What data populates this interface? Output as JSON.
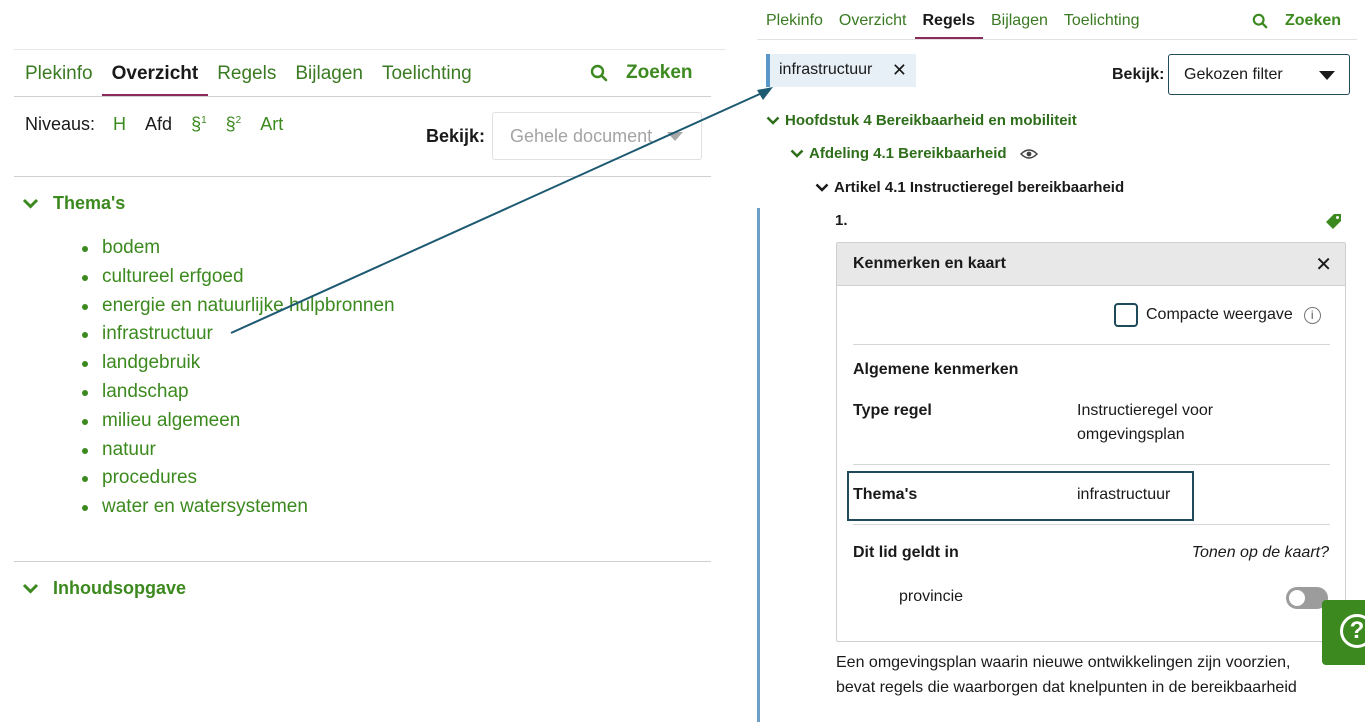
{
  "left": {
    "tabs": [
      "Plekinfo",
      "Overzicht",
      "Regels",
      "Bijlagen",
      "Toelichting"
    ],
    "active_tab": "Overzicht",
    "search_label": "Zoeken",
    "levels_label": "Niveaus:",
    "levels": {
      "h": "H",
      "afd": "Afd",
      "p1": "§",
      "p1_sup": "1",
      "p2": "§",
      "p2_sup": "2",
      "art": "Art"
    },
    "view_label": "Bekijk:",
    "view_value": "Gehele document",
    "themes_heading": "Thema's",
    "themes": [
      "bodem",
      "cultureel erfgoed",
      "energie en natuurlijke hulpbronnen",
      "infrastructuur",
      "landgebruik",
      "landschap",
      "milieu algemeen",
      "natuur",
      "procedures",
      "water en watersystemen"
    ],
    "contents_heading": "Inhoudsopgave"
  },
  "right": {
    "tabs": [
      "Plekinfo",
      "Overzicht",
      "Regels",
      "Bijlagen",
      "Toelichting"
    ],
    "active_tab": "Regels",
    "search_label": "Zoeken",
    "filter_chip": "infrastructuur",
    "view_label": "Bekijk:",
    "view_value": "Gekozen filter",
    "toc": {
      "chapter": "Hoofdstuk 4 Bereikbaarheid en mobiliteit",
      "section": "Afdeling 4.1 Bereikbaarheid",
      "article": "Artikel 4.1 Instructieregel bereikbaarheid"
    },
    "lid_number": "1.",
    "card": {
      "title": "Kenmerken en kaart",
      "compact_label": "Compacte weergave",
      "general_heading": "Algemene kenmerken",
      "type_label": "Type regel",
      "type_value_line1": "Instructieregel voor",
      "type_value_line2": "omgevingsplan",
      "themes_label": "Thema's",
      "themes_value": "infrastructuur",
      "applies_label": "Dit lid geldt in",
      "map_question": "Tonen op de kaart?",
      "area": "provincie"
    },
    "body_line1": "Een omgevingsplan waarin nieuwe ontwikkelingen zijn voorzien,",
    "body_line2": "bevat regels die waarborgen dat knelpunten in de bereikbaarheid"
  },
  "colors": {
    "green": "#3c8a1f",
    "active_underline": "#8a2b5c",
    "arrow": "#1d5a72",
    "navy_border": "#1f4a5a"
  },
  "icons": [
    "search-icon",
    "chevron-down-icon",
    "close-icon",
    "eye-icon",
    "tag-icon",
    "info-icon",
    "help-icon"
  ]
}
